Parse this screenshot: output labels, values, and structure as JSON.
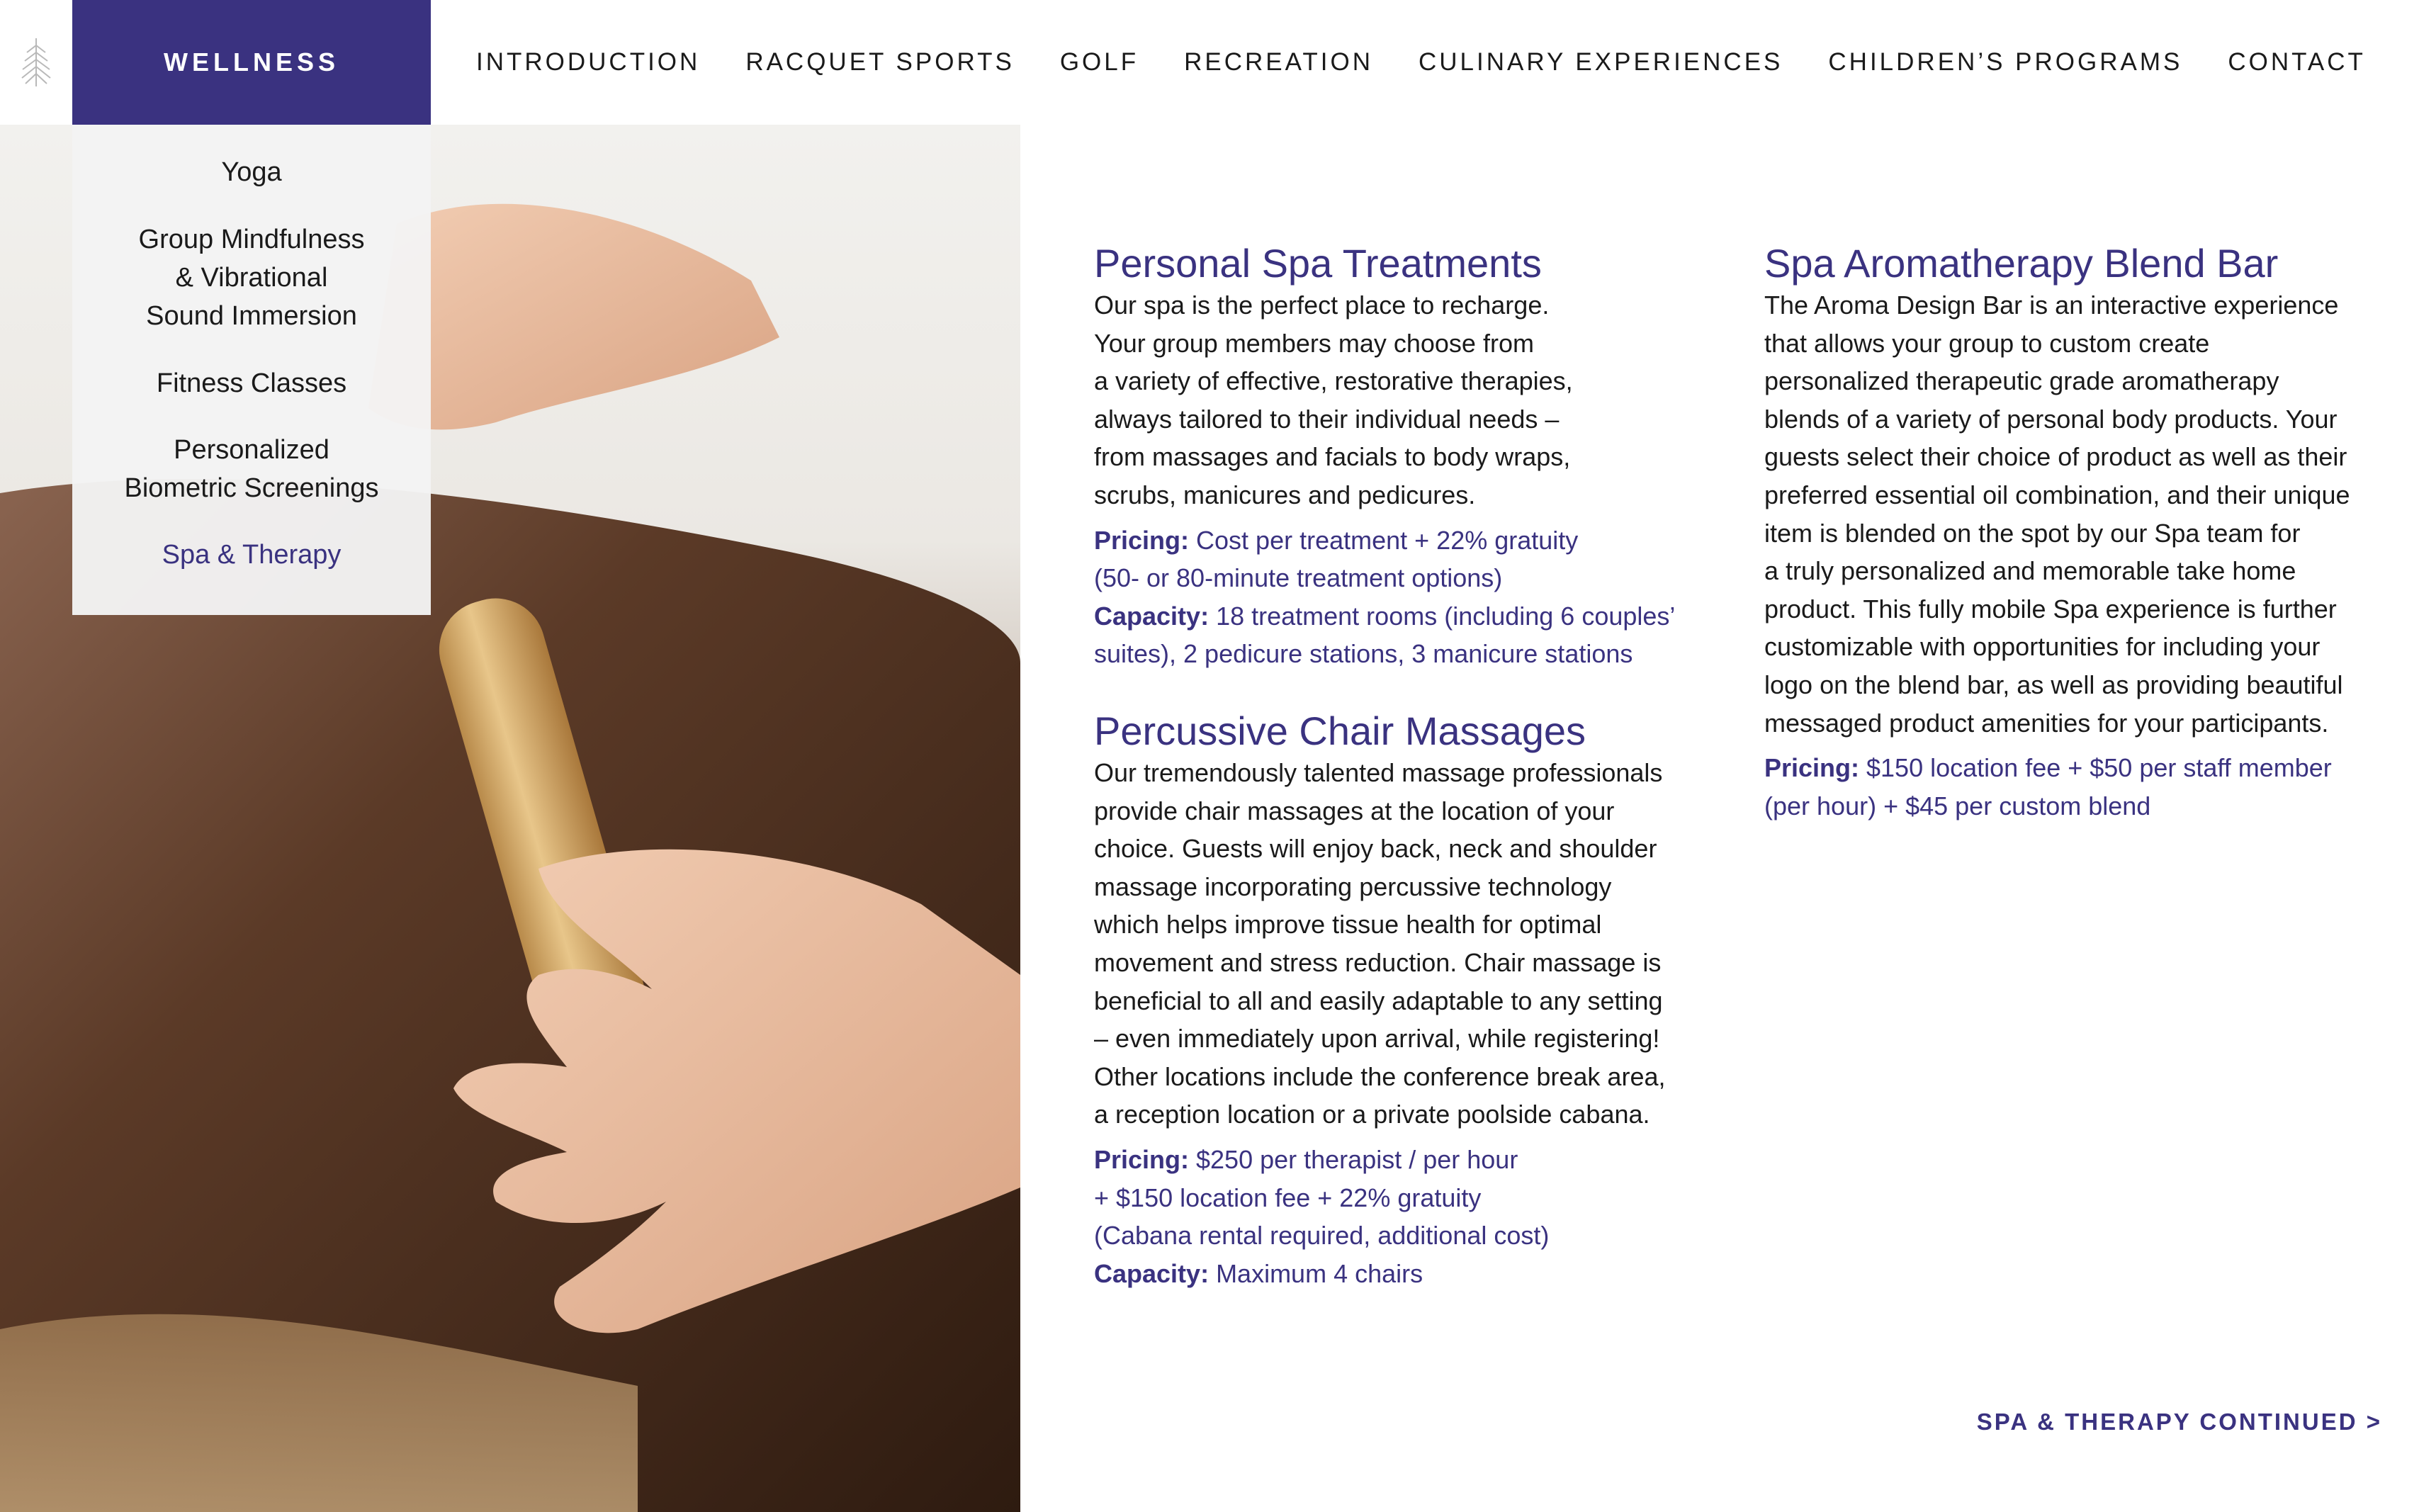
{
  "nav": {
    "active_tab": "WELLNESS",
    "items": [
      "INTRODUCTION",
      "RACQUET SPORTS",
      "GOLF",
      "RECREATION",
      "CULINARY EXPERIENCES",
      "CHILDREN’S PROGRAMS",
      "CONTACT"
    ]
  },
  "dropdown": {
    "items": [
      "Yoga",
      "Group Mindfulness\n& Vibrational\nSound Immersion",
      "Fitness Classes",
      "Personalized\nBiometric Screenings",
      "Spa & Therapy"
    ],
    "active_index": 4
  },
  "sections": {
    "personal_spa": {
      "title": "Personal Spa Treatments",
      "body": "Our spa is the perfect place to recharge.\nYour group members may choose from\na variety of effective, restorative therapies,\nalways tailored to their individual needs –\nfrom massages and facials to body wraps,\nscrubs, manicures and pedicures.",
      "pricing_label": "Pricing:",
      "pricing": " Cost per treatment + 22% gratuity\n(50- or 80-minute treatment options)",
      "capacity_label": "Capacity:",
      "capacity": " 18 treatment rooms (including 6 couples’\nsuites), 2 pedicure stations, 3 manicure stations"
    },
    "percussive": {
      "title": "Percussive Chair Massages",
      "body": "Our tremendously talented massage professionals\nprovide chair massages at the location of your\nchoice. Guests will enjoy back, neck and shoulder\nmassage incorporating percussive technology\nwhich helps improve tissue health for optimal\nmovement and stress reduction. Chair massage is\nbeneficial to all and easily adaptable to any setting\n– even immediately upon arrival, while registering!\nOther locations include the conference break area,\na reception location or a private poolside cabana.",
      "pricing_label": "Pricing:",
      "pricing": " $250 per therapist / per hour\n+ $150 location fee + 22% gratuity\n(Cabana rental required, additional cost)",
      "capacity_label": "Capacity:",
      "capacity": " Maximum 4 chairs"
    },
    "aroma": {
      "title": "Spa Aromatherapy Blend Bar",
      "body": "The Aroma Design Bar is an interactive experience\nthat allows your group to custom create\npersonalized therapeutic grade aromatherapy\nblends of a variety of personal body products. Your\nguests select their choice of product as well as their\npreferred essential oil combination, and their unique\nitem is blended on the spot by our Spa team for\na truly personalized and memorable take home\nproduct. This fully mobile Spa experience is further\ncustomizable with opportunities for including your\nlogo on the blend bar, as well as providing beautiful\nmessaged product amenities for your participants.",
      "pricing_label": "Pricing:",
      "pricing": " $150 location fee + $50 per staff member\n(per hour) + $45 per custom blend"
    }
  },
  "continue_link": "SPA & THERAPY CONTINUED >",
  "colors": {
    "accent": "#3a3280",
    "text": "#1a1a1a",
    "dropdown_bg": "#f3f3f3"
  },
  "icons": {
    "logo": "tree-logo-icon"
  }
}
